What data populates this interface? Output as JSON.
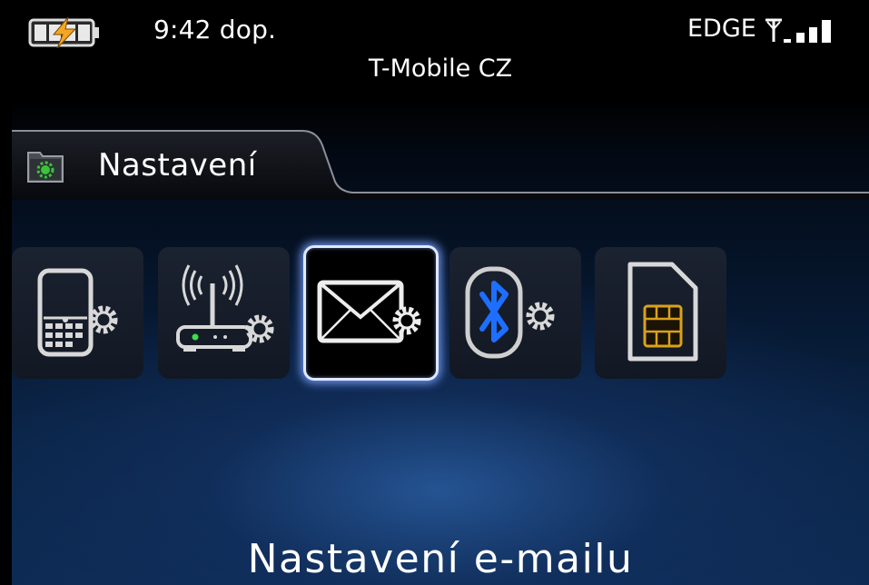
{
  "status_bar": {
    "time": "9:42 dop.",
    "network": "EDGE",
    "carrier": "T-Mobile CZ",
    "battery_icon": "battery-charging-icon",
    "signal_icon": "signal-strength-icon"
  },
  "folder": {
    "title": "Nastavení",
    "icon": "settings-folder-icon"
  },
  "icons": [
    {
      "name": "device-options-icon",
      "selected": false
    },
    {
      "name": "wireless-network-options-icon",
      "selected": false
    },
    {
      "name": "email-settings-icon",
      "selected": true
    },
    {
      "name": "bluetooth-options-icon",
      "selected": false
    },
    {
      "name": "sim-card-icon",
      "selected": false
    }
  ],
  "selected_label": "Nastavení e-mailu",
  "colors": {
    "accent_selection": "#dfe8ff",
    "bluetooth_blue": "#1e6fff",
    "sim_gold": "#d9a21b",
    "led_green": "#3ae04a"
  }
}
